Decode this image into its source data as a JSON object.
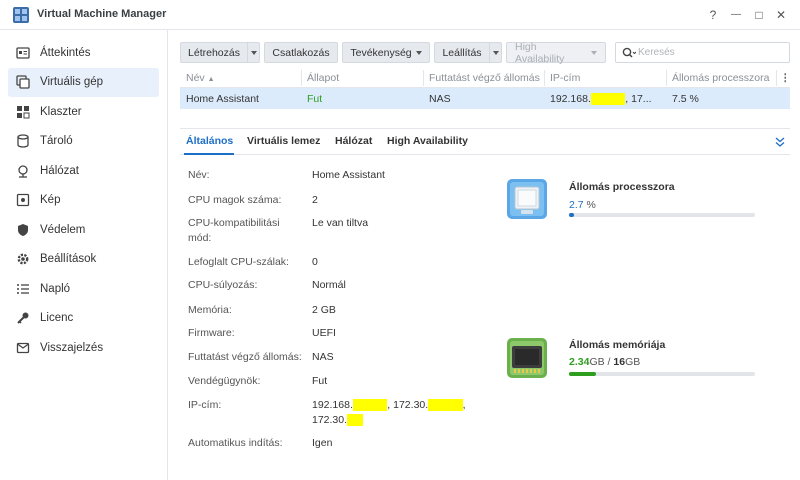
{
  "app": {
    "title": "Virtual Machine Manager",
    "help_label": "?",
    "minimize_label": "—",
    "maximize_label": "□",
    "close_label": "✕"
  },
  "sidebar": {
    "items": [
      {
        "label": "Áttekintés",
        "icon": "overview-icon",
        "active": false
      },
      {
        "label": "Virtuális gép",
        "icon": "virtual-machine-icon",
        "active": true
      },
      {
        "label": "Klaszter",
        "icon": "cluster-icon",
        "active": false
      },
      {
        "label": "Tároló",
        "icon": "storage-icon",
        "active": false
      },
      {
        "label": "Hálózat",
        "icon": "network-icon",
        "active": false
      },
      {
        "label": "Kép",
        "icon": "image-icon",
        "active": false
      },
      {
        "label": "Védelem",
        "icon": "shield-icon",
        "active": false
      },
      {
        "label": "Beállítások",
        "icon": "gear-icon",
        "active": false
      },
      {
        "label": "Napló",
        "icon": "log-icon",
        "active": false
      },
      {
        "label": "Licenc",
        "icon": "key-icon",
        "active": false
      },
      {
        "label": "Visszajelzés",
        "icon": "feedback-icon",
        "active": false
      }
    ]
  },
  "toolbar": {
    "create": "Létrehozás",
    "connect": "Csatlakozás",
    "action": "Tevékenység",
    "shutdown": "Leállítás",
    "high_availability": "High Availability",
    "search_placeholder": "Keresés"
  },
  "grid": {
    "columns": [
      "Név",
      "Állapot",
      "Futtatást végző állomás",
      "IP-cím",
      "Állomás processzora"
    ],
    "rows": [
      {
        "name": "Home Assistant",
        "status": "Fut",
        "host": "NAS",
        "ip_prefix": "192.168.",
        "ip_redacted": "xxx.xxx",
        "ip_suffix": ", 17...",
        "cpu": "7.5 %"
      }
    ],
    "status_color": "#2e9e1f"
  },
  "detail": {
    "tabs": [
      "Általános",
      "Virtuális lemez",
      "Hálózat",
      "High Availability"
    ],
    "active_tab": 0,
    "properties": [
      {
        "label": "Név:",
        "value": "Home Assistant"
      },
      {
        "label": "CPU magok száma:",
        "value": "2"
      },
      {
        "label": "CPU-kompatibilitási",
        "label2": "mód:",
        "value": "Le van tiltva"
      },
      {
        "label": "Lefoglalt CPU-szálak:",
        "value": "0"
      },
      {
        "label": "CPU-súlyozás:",
        "value": "Normál"
      },
      {
        "label": "Memória:",
        "value": "2 GB"
      },
      {
        "label": "Firmware:",
        "value": "UEFI"
      },
      {
        "label": "Futtatást végző állomás:",
        "value": "NAS"
      },
      {
        "label": "Vendégügynök:",
        "value": "Fut"
      },
      {
        "label": "IP-cím:",
        "value_parts": [
          "192.168.",
          "xxx.xxx",
          ", 172.30.",
          "xxx.xxx",
          ",",
          "172.30.",
          "xxx"
        ]
      },
      {
        "label": "Automatikus indítás:",
        "value": "Igen"
      }
    ]
  },
  "resources": {
    "cpu": {
      "title": "Állomás processzora",
      "value": "2.7",
      "unit": "%",
      "percent": 2.7,
      "color": "#1e6fc8"
    },
    "memory": {
      "title": "Állomás memóriája",
      "used": "2.34",
      "used_unit": "GB",
      "sep": "/",
      "total": "16",
      "total_unit": "GB",
      "percent": 14.6,
      "color": "#2e9e1f"
    }
  }
}
